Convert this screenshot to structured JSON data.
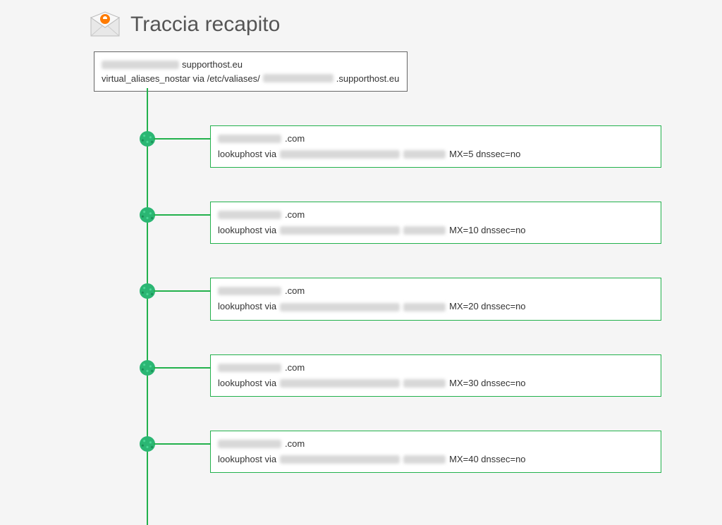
{
  "header": {
    "title": "Traccia recapito"
  },
  "root": {
    "address_suffix": "supporthost.eu",
    "resolution_prefix": "virtual_aliases_nostar via /etc/valiases/",
    "resolution_suffix": ".supporthost.eu"
  },
  "hops": [
    {
      "address_suffix": ".com",
      "lookup_prefix": "lookuphost via",
      "mx": "MX=5 dnssec=no"
    },
    {
      "address_suffix": ".com",
      "lookup_prefix": "lookuphost via",
      "mx": "MX=10 dnssec=no"
    },
    {
      "address_suffix": ".com",
      "lookup_prefix": "lookuphost via",
      "mx": "MX=20 dnssec=no"
    },
    {
      "address_suffix": ".com",
      "lookup_prefix": "lookuphost via",
      "mx": "MX=30 dnssec=no"
    },
    {
      "address_suffix": ".com",
      "lookup_prefix": "lookuphost via",
      "mx": "MX=40 dnssec=no"
    }
  ]
}
